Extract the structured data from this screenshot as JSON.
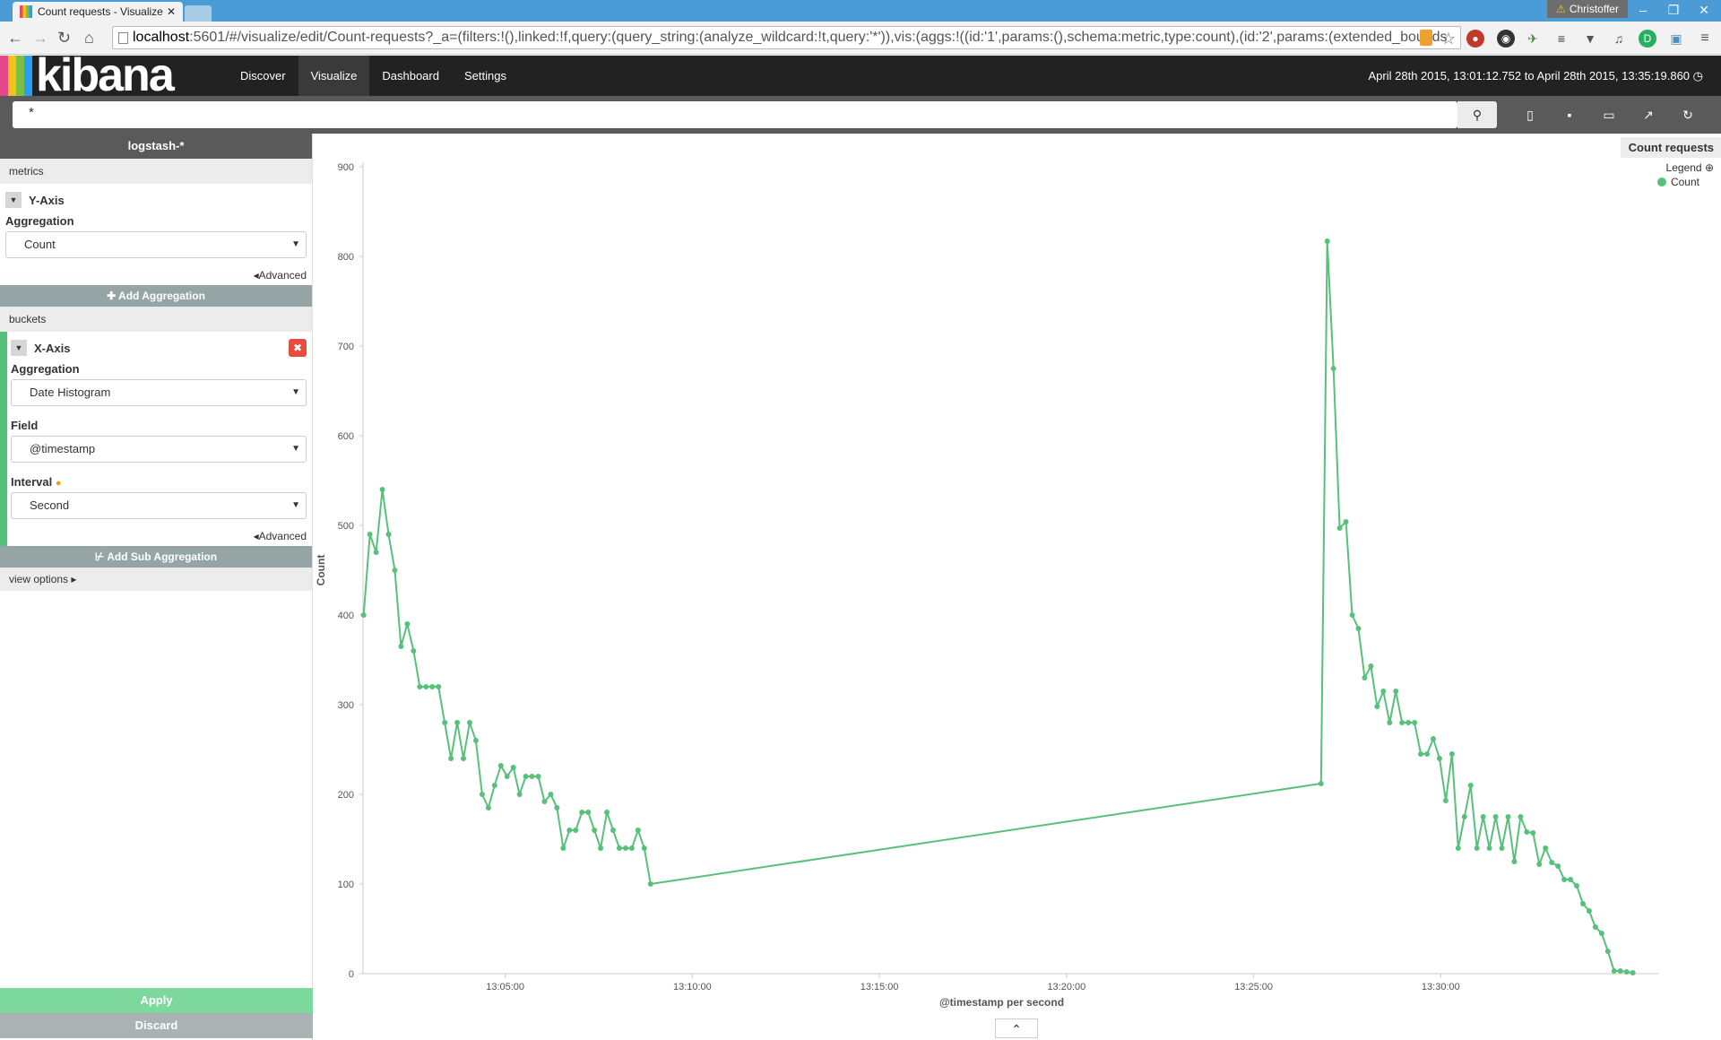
{
  "browser": {
    "tab_title": "Count requests - Visualize",
    "tab_close": "✕",
    "user": "Christoffer",
    "url_host": "localhost",
    "url_rest": ":5601/#/visualize/edit/Count-requests?_a=(filters:!(),linked:!f,query:(query_string:(analyze_wildcard:!t,query:'*')),vis:(aggs:!((id:'1',params:(),schema:metric,type:count),(id:'2',params:(extended_bounds"
  },
  "kibana": {
    "logo": "kibana",
    "nav": [
      "Discover",
      "Visualize",
      "Dashboard",
      "Settings"
    ],
    "active_nav": "Visualize",
    "time_range": "April 28th 2015, 13:01:12.752 to April 28th 2015, 13:35:19.860",
    "query": "*"
  },
  "sidebar": {
    "index": "logstash-*",
    "metrics_label": "metrics",
    "y_axis": {
      "title": "Y-Axis",
      "agg_label": "Aggregation",
      "agg_value": "Count",
      "advanced": "Advanced"
    },
    "add_aggregation": "Add Aggregation",
    "buckets_label": "buckets",
    "x_axis": {
      "title": "X-Axis",
      "agg_label": "Aggregation",
      "agg_value": "Date Histogram",
      "field_label": "Field",
      "field_value": "@timestamp",
      "interval_label": "Interval",
      "interval_value": "Second",
      "advanced": "Advanced"
    },
    "add_sub_aggregation": "Add Sub Aggregation",
    "view_options": "view options",
    "apply": "Apply",
    "discard": "Discard"
  },
  "legend": {
    "title": "Count requests",
    "label": "Legend",
    "items": [
      "Count"
    ]
  },
  "colors": {
    "series": "#57c17b",
    "header_bg": "#222222",
    "accent": "#57c17b"
  },
  "chart_data": {
    "type": "line",
    "xlabel": "@timestamp per second",
    "ylabel": "Count",
    "ylim": [
      0,
      900
    ],
    "yticks": [
      0,
      100,
      200,
      300,
      400,
      500,
      600,
      700,
      800,
      900
    ],
    "xlim": [
      "13:01:12",
      "13:35:20"
    ],
    "xticks": [
      "13:05:00",
      "13:10:00",
      "13:15:00",
      "13:20:00",
      "13:25:00",
      "13:30:00"
    ],
    "grid": false,
    "legend_position": "top-right",
    "series": [
      {
        "name": "Count",
        "x": [
          "13:01:13",
          "13:01:23",
          "13:01:33",
          "13:01:43",
          "13:01:53",
          "13:02:03",
          "13:02:13",
          "13:02:23",
          "13:02:33",
          "13:02:43",
          "13:02:53",
          "13:03:03",
          "13:03:13",
          "13:03:23",
          "13:03:33",
          "13:03:43",
          "13:03:53",
          "13:04:03",
          "13:04:13",
          "13:04:23",
          "13:04:33",
          "13:04:43",
          "13:04:53",
          "13:05:03",
          "13:05:13",
          "13:05:23",
          "13:05:33",
          "13:05:43",
          "13:05:53",
          "13:06:03",
          "13:06:13",
          "13:06:23",
          "13:06:33",
          "13:06:43",
          "13:06:53",
          "13:07:03",
          "13:07:13",
          "13:07:23",
          "13:07:33",
          "13:07:43",
          "13:07:53",
          "13:08:03",
          "13:08:13",
          "13:08:23",
          "13:08:33",
          "13:08:43",
          "13:08:53",
          "13:26:48",
          "13:26:58",
          "13:27:08",
          "13:27:18",
          "13:27:28",
          "13:27:38",
          "13:27:48",
          "13:27:58",
          "13:28:08",
          "13:28:18",
          "13:28:28",
          "13:28:38",
          "13:28:48",
          "13:28:58",
          "13:29:08",
          "13:29:18",
          "13:29:28",
          "13:29:38",
          "13:29:48",
          "13:29:58",
          "13:30:08",
          "13:30:18",
          "13:30:28",
          "13:30:38",
          "13:30:48",
          "13:30:58",
          "13:31:08",
          "13:31:18",
          "13:31:28",
          "13:31:38",
          "13:31:48",
          "13:31:58",
          "13:32:08",
          "13:32:18",
          "13:32:28",
          "13:32:38",
          "13:32:48",
          "13:32:58",
          "13:33:08",
          "13:33:18",
          "13:33:28",
          "13:33:38",
          "13:33:48",
          "13:33:58",
          "13:34:08",
          "13:34:18",
          "13:34:28",
          "13:34:38",
          "13:34:48",
          "13:34:58",
          "13:35:08"
        ],
        "values": [
          400,
          490,
          470,
          540,
          490,
          450,
          365,
          390,
          360,
          320,
          320,
          320,
          320,
          280,
          240,
          280,
          240,
          280,
          260,
          200,
          185,
          210,
          232,
          220,
          230,
          200,
          220,
          220,
          220,
          192,
          200,
          185,
          140,
          160,
          160,
          180,
          180,
          160,
          140,
          180,
          160,
          140,
          140,
          140,
          160,
          140,
          100,
          212,
          817,
          675,
          497,
          504,
          400,
          385,
          330,
          343,
          298,
          315,
          280,
          315,
          280,
          280,
          280,
          245,
          245,
          262,
          240,
          193,
          245,
          140,
          175,
          210,
          140,
          175,
          140,
          175,
          140,
          175,
          125,
          175,
          158,
          157,
          122,
          140,
          124,
          120,
          105,
          105,
          98,
          78,
          70,
          52,
          45,
          25,
          3,
          3,
          2,
          1
        ]
      }
    ]
  }
}
